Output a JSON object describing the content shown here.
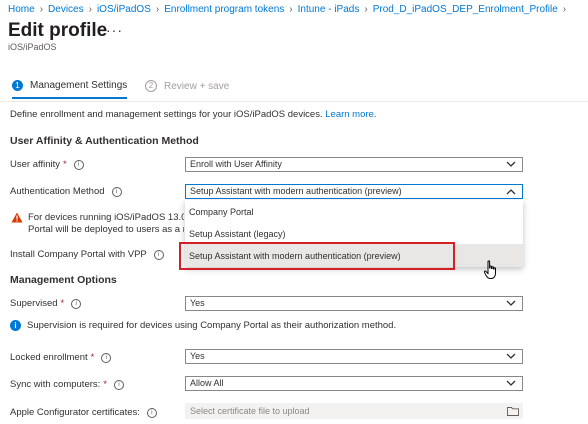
{
  "breadcrumb": [
    "Home",
    "Devices",
    "iOS/iPadOS",
    "Enrollment program tokens",
    "Intune - iPads",
    "Prod_D_iPadOS_DEP_Enrolment_Profile"
  ],
  "header": {
    "title": "Edit profile",
    "more": "···",
    "subtitle": "iOS/iPadOS"
  },
  "steps": [
    {
      "num": "1",
      "label": "Management Settings"
    },
    {
      "num": "2",
      "label": "Review + save"
    }
  ],
  "description": {
    "text": "Define enrollment and management settings for your iOS/iPadOS devices.",
    "link": "Learn more."
  },
  "sections": {
    "affinity": "User Affinity & Authentication Method",
    "management": "Management Options"
  },
  "fields": {
    "user_affinity": {
      "label": "User affinity",
      "req": "*",
      "value": "Enroll with User Affinity"
    },
    "auth_method": {
      "label": "Authentication Method",
      "value": "Setup Assistant with modern authentication (preview)"
    },
    "install_cp": {
      "label": "Install Company Portal with VPP"
    },
    "supervised": {
      "label": "Supervised",
      "req": "*",
      "value": "Yes"
    },
    "locked_enrollment": {
      "label": "Locked enrollment",
      "req": "*",
      "value": "Yes"
    },
    "sync": {
      "label": "Sync with computers:",
      "req": "*",
      "value": "Allow All"
    },
    "apple_cert": {
      "label": "Apple Configurator certificates:",
      "placeholder": "Select certificate file to upload"
    }
  },
  "auth_menu": [
    "Company Portal",
    "Setup Assistant (legacy)",
    "Setup Assistant with modern authentication (preview)"
  ],
  "warning": {
    "line1": "For devices running iOS/iPadOS 13.0 and later",
    "line2": "Portal will be deployed to users as a required app"
  },
  "info_banner": "Supervision is required for devices using Company Portal as their authorization method.",
  "colors": {
    "accent": "#0078d4",
    "highlight_border": "#d32027",
    "warning": "#d83b01"
  }
}
